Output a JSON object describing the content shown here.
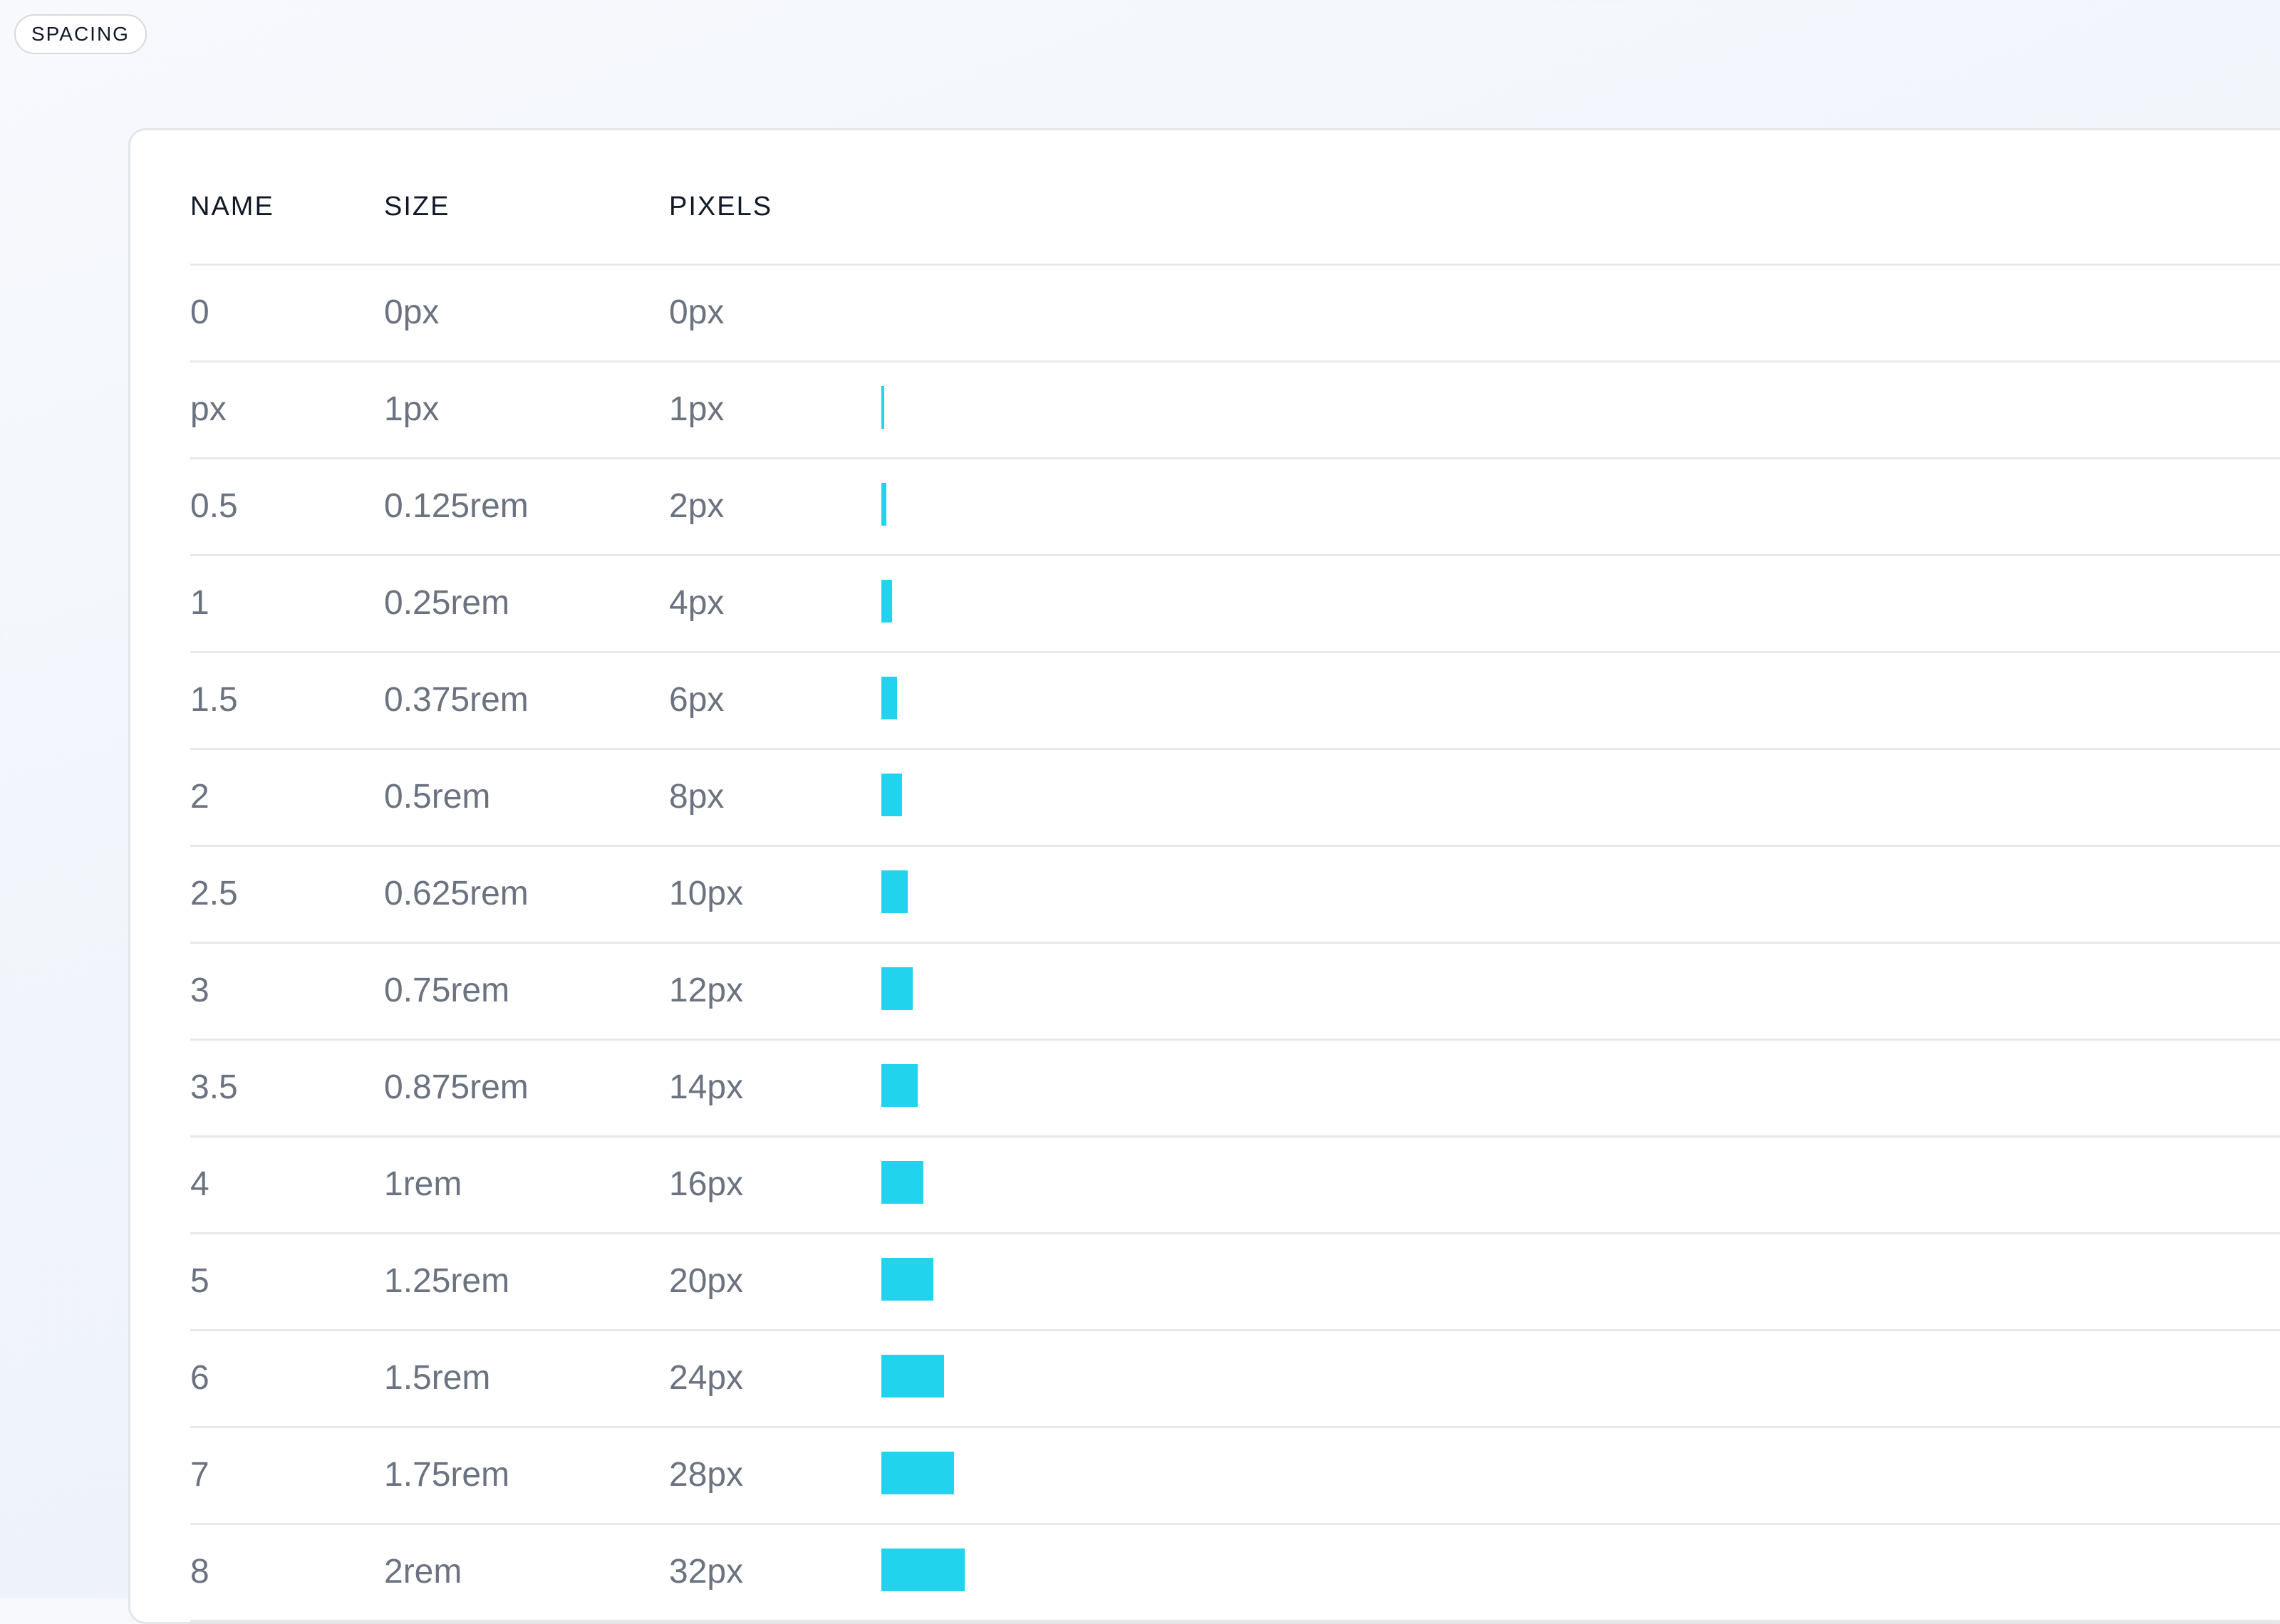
{
  "section_badge": "SPACING",
  "table": {
    "headers": {
      "name": "NAME",
      "size": "SIZE",
      "pixels": "PIXELS"
    },
    "rows": [
      {
        "name": "0",
        "size": "0px",
        "pixels": "0px",
        "value": 0
      },
      {
        "name": "px",
        "size": "1px",
        "pixels": "1px",
        "value": 1
      },
      {
        "name": "0.5",
        "size": "0.125rem",
        "pixels": "2px",
        "value": 2
      },
      {
        "name": "1",
        "size": "0.25rem",
        "pixels": "4px",
        "value": 4
      },
      {
        "name": "1.5",
        "size": "0.375rem",
        "pixels": "6px",
        "value": 6
      },
      {
        "name": "2",
        "size": "0.5rem",
        "pixels": "8px",
        "value": 8
      },
      {
        "name": "2.5",
        "size": "0.625rem",
        "pixels": "10px",
        "value": 10
      },
      {
        "name": "3",
        "size": "0.75rem",
        "pixels": "12px",
        "value": 12
      },
      {
        "name": "3.5",
        "size": "0.875rem",
        "pixels": "14px",
        "value": 14
      },
      {
        "name": "4",
        "size": "1rem",
        "pixels": "16px",
        "value": 16
      },
      {
        "name": "5",
        "size": "1.25rem",
        "pixels": "20px",
        "value": 20
      },
      {
        "name": "6",
        "size": "1.5rem",
        "pixels": "24px",
        "value": 24
      },
      {
        "name": "7",
        "size": "1.75rem",
        "pixels": "28px",
        "value": 28
      },
      {
        "name": "8",
        "size": "2rem",
        "pixels": "32px",
        "value": 32
      }
    ]
  },
  "colors": {
    "bar": "#22d3ee"
  }
}
